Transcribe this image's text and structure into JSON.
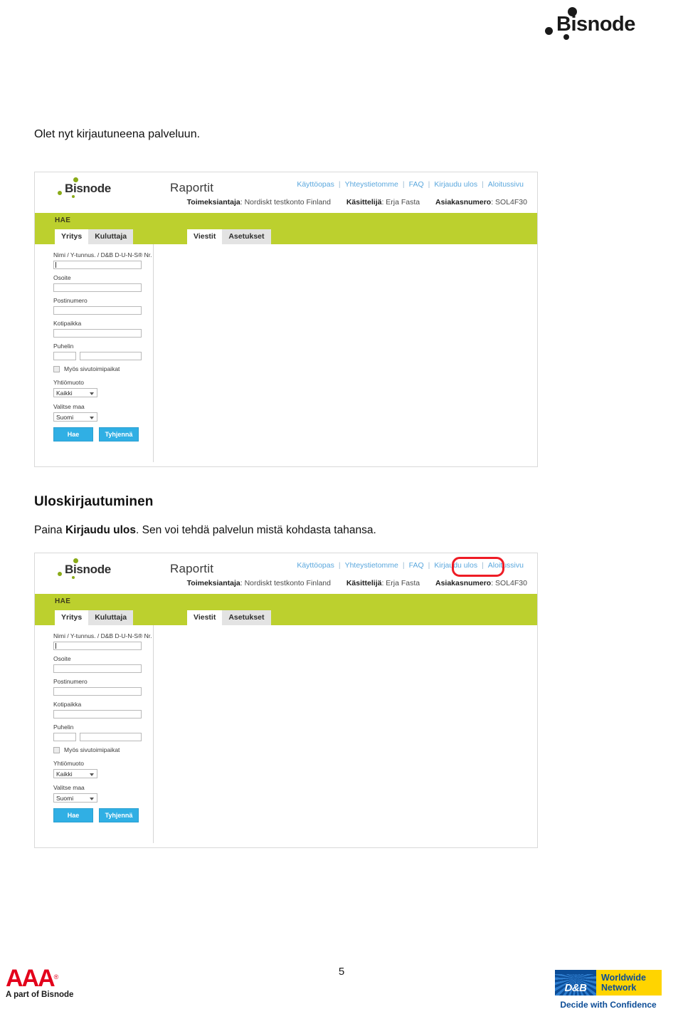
{
  "page": {
    "brand": "Bisnode",
    "intro_line": "Olet nyt kirjautuneena palveluun.",
    "section_heading": "Uloskirjautuminen",
    "paragraph_before": "Paina ",
    "paragraph_bold": "Kirjaudu ulos",
    "paragraph_after": ". Sen voi tehdä palvelun mistä kohdasta tahansa.",
    "page_number": "5"
  },
  "app": {
    "logo_word": "Bisnode",
    "title": "Raportit",
    "nav": {
      "separator": "|",
      "links": [
        "Käyttöopas",
        "Yhteystietomme",
        "FAQ",
        "Kirjaudu ulos",
        "Aloitussivu"
      ]
    },
    "info": [
      {
        "label": "Toimeksiantaja",
        "value": "Nordiskt testkonto Finland"
      },
      {
        "label": "Käsittelijä",
        "value": "Erja Fasta"
      },
      {
        "label": "Asiakasnumero",
        "value": "SOL4F30"
      }
    ],
    "search_band": {
      "title": "HAE",
      "tabs_left": [
        {
          "label": "Yritys",
          "state": "active"
        },
        {
          "label": "Kuluttaja",
          "state": "inactive"
        }
      ],
      "tabs_right": [
        {
          "label": "Viestit",
          "state": "active"
        },
        {
          "label": "Asetukset",
          "state": "inactive"
        }
      ]
    },
    "form": {
      "name_label": "Nimi / Y-tunnus. / D&B D-U-N-S® Nr.",
      "name_value": "",
      "address_label": "Osoite",
      "address_value": "",
      "postal_label": "Postinumero",
      "postal_value": "",
      "city_label": "Kotipaikka",
      "city_value": "",
      "phone_label": "Puhelin",
      "phone_prefix_value": "",
      "phone_number_value": "",
      "branches_checkbox_label": "Myös sivutoimipaikat",
      "company_form_label": "Yhtiömuoto",
      "company_form_value": "Kaikki",
      "country_label": "Valitse maa",
      "country_value": "Suomi",
      "search_button": "Hae",
      "clear_button": "Tyhjennä"
    }
  },
  "annotation": {
    "target_link": "Kirjaudu ulos",
    "color": "#ee1c25"
  },
  "footer": {
    "aaa": {
      "mark": "AAA",
      "registered": "®",
      "subtitle": "A part of Bisnode"
    },
    "dnb": {
      "badge": "D&B",
      "line1": "Worldwide",
      "line2": "Network",
      "tagline": "Decide with Confidence"
    }
  },
  "colors": {
    "green_band": "#bcd02e",
    "link_blue": "#5aa7dd",
    "button_blue": "#30afe4",
    "annotation_red": "#ee1c25",
    "aaa_red": "#e3001b",
    "dnb_blue": "#0b4c96",
    "dnb_yellow": "#ffd400"
  }
}
